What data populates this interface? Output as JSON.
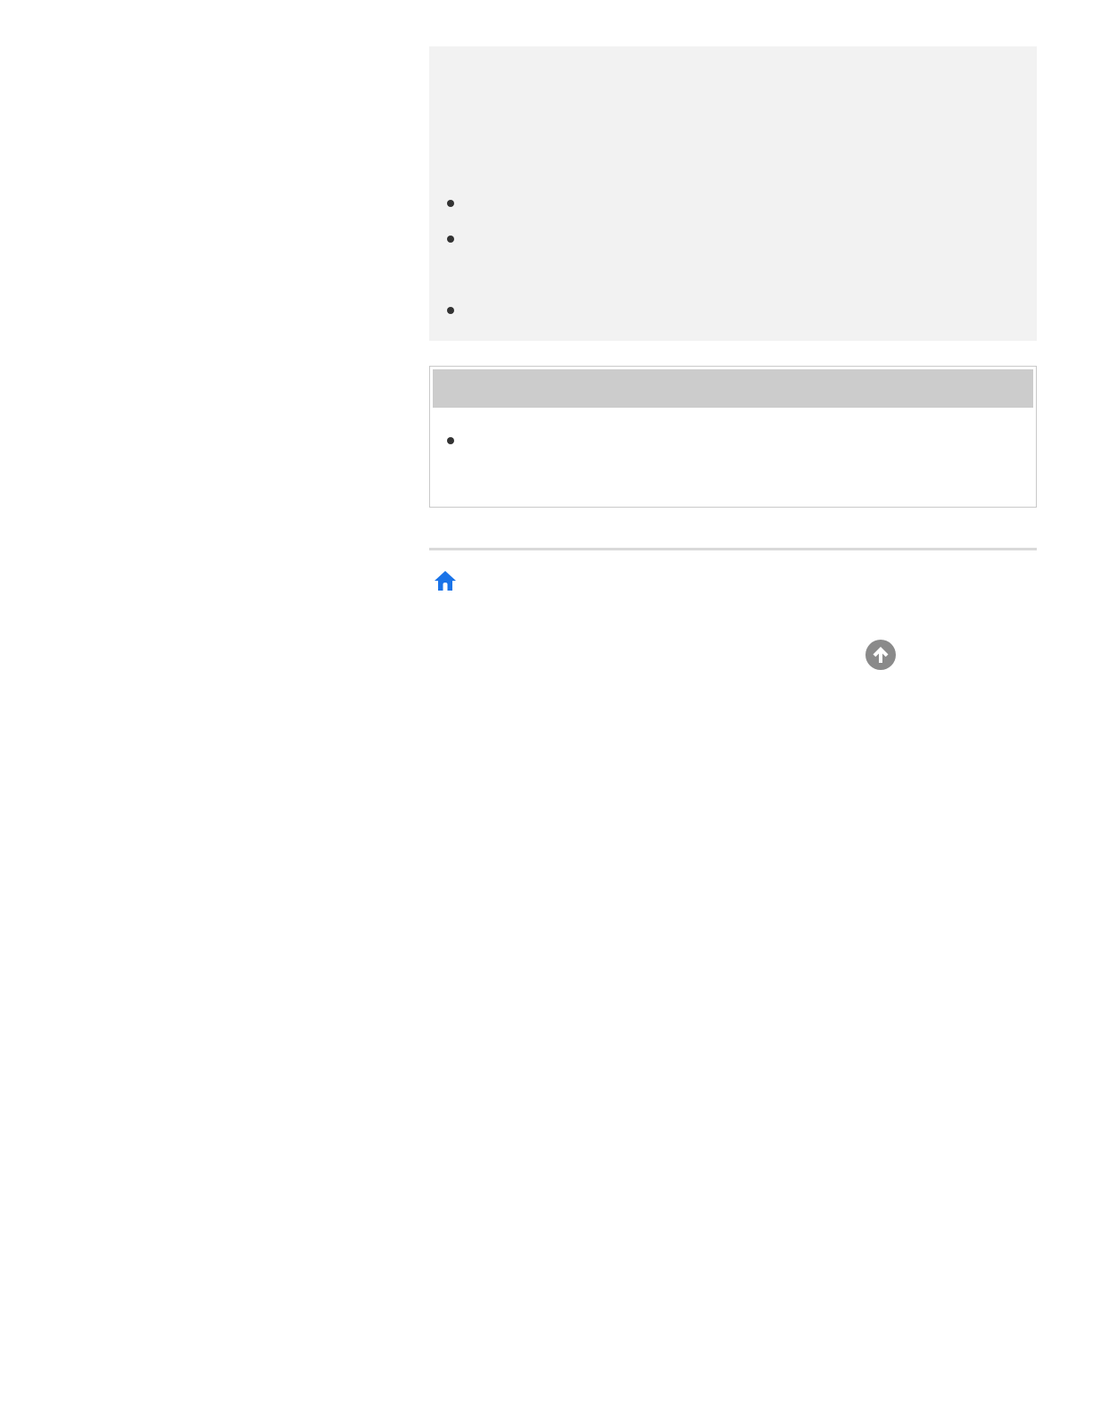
{
  "info_panel": {
    "items": [
      {
        "text": ""
      },
      {
        "text": ""
      },
      {
        "text": ""
      }
    ]
  },
  "note": {
    "header": "",
    "items": [
      {
        "text": ""
      }
    ]
  },
  "footer": {
    "home_icon": "home-icon",
    "back_to_top_icon": "arrow-up-circle-icon"
  },
  "colors": {
    "home_icon": "#1a73e8",
    "back_to_top_button": "#8a8a8a",
    "panel_background": "#f2f2f2",
    "note_header_background": "#cccccc"
  }
}
